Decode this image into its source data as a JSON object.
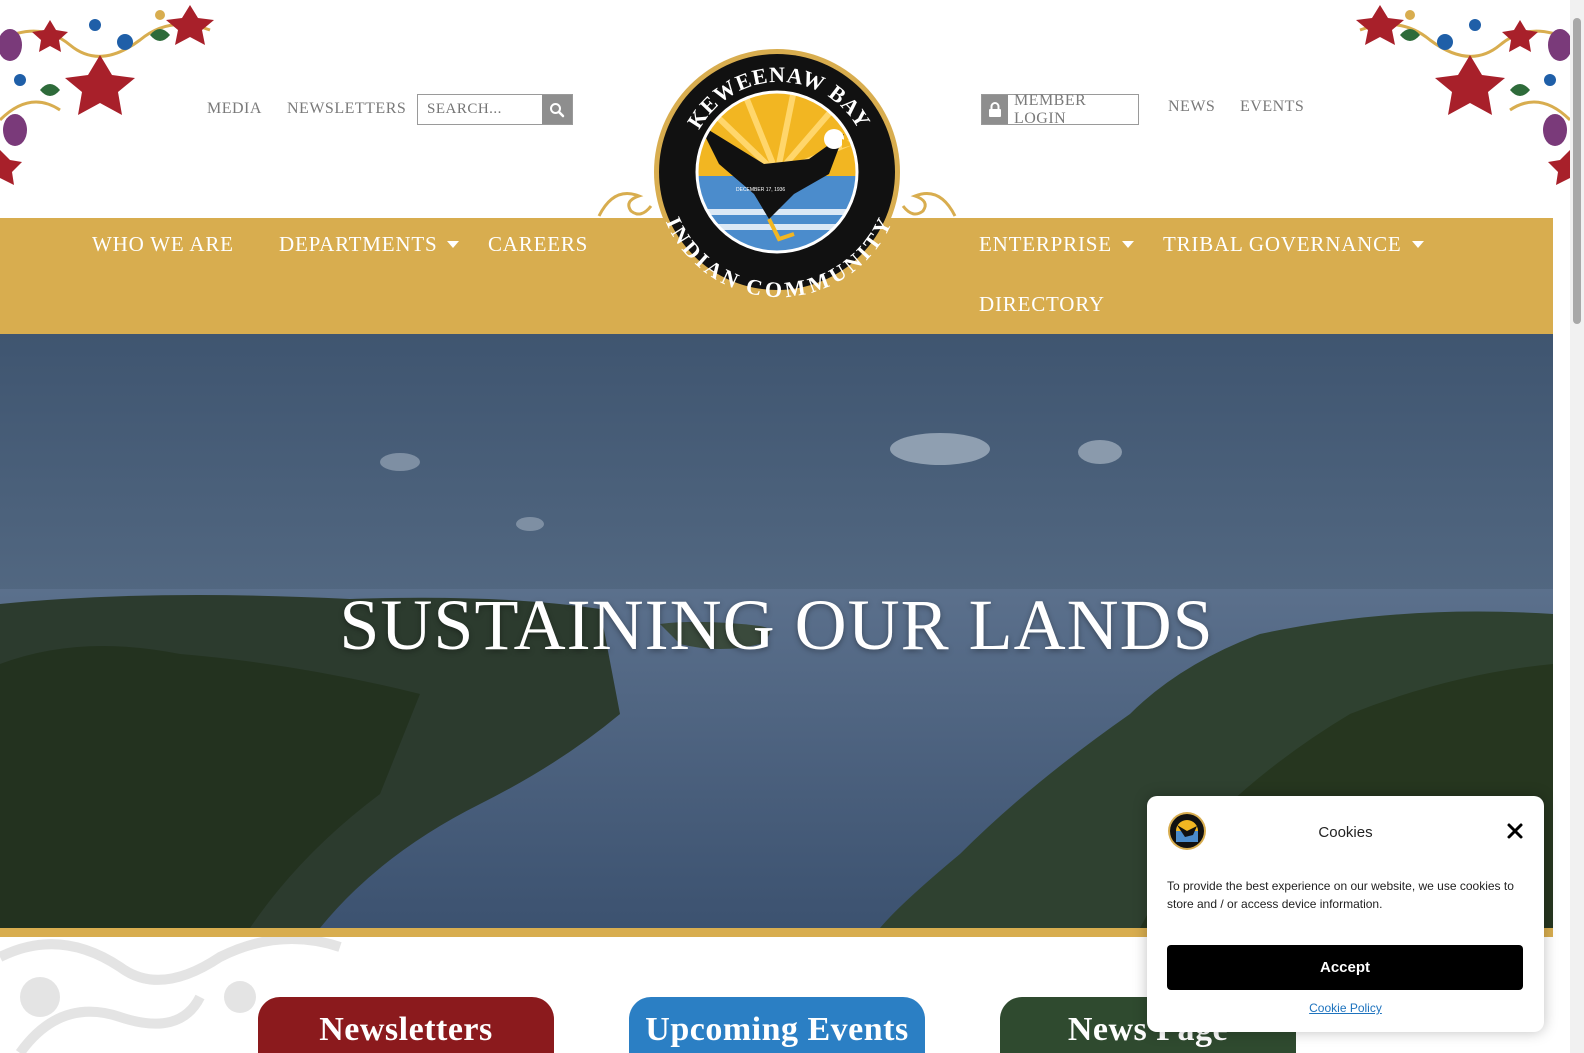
{
  "util_nav": {
    "media": "MEDIA",
    "newsletters": "NEWSLETTERS",
    "search_placeholder": "SEARCH...",
    "member_login": "MEMBER LOGIN",
    "news": "NEWS",
    "events": "EVENTS"
  },
  "main_nav": {
    "who_we_are": "WHO WE ARE",
    "departments": "DEPARTMENTS",
    "careers": "CAREERS",
    "enterprise": "ENTERPRISE",
    "tribal_governance": "TRIBAL GOVERNANCE",
    "directory": "DIRECTORY"
  },
  "logo": {
    "top_text": "KEWEENAW BAY",
    "bottom_text": "INDIAN COMMUNITY",
    "date_text": "DECEMBER 17, 1936"
  },
  "hero": {
    "title": "SUSTAINING OUR LANDS"
  },
  "cards": {
    "newsletters": "Newsletters",
    "upcoming_events": "Upcoming Events",
    "news_page": "News Page"
  },
  "cookie": {
    "title": "Cookies",
    "text": "To provide the best experience on our website, we use cookies to store and / or access device information.",
    "accept": "Accept",
    "policy": "Cookie Policy"
  },
  "colors": {
    "gold": "#d8ad4f",
    "card_red": "#8b1a1d",
    "card_blue": "#2b7fc4",
    "card_green": "#2f4a2f"
  }
}
